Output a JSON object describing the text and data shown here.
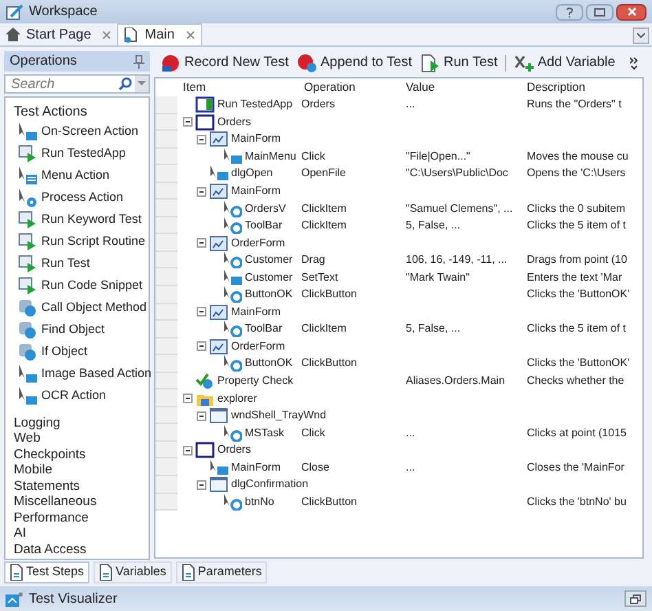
{
  "window": {
    "title": "Workspace"
  },
  "tabs": [
    {
      "label": "Start Page",
      "kind": "home",
      "selected": false
    },
    {
      "label": "Main",
      "kind": "test",
      "selected": true
    }
  ],
  "operations": {
    "title": "Operations",
    "search": {
      "placeholder": "Search"
    },
    "group": "Test Actions",
    "actions": [
      {
        "label": "On-Screen Action",
        "kind": "screen"
      },
      {
        "label": "Run TestedApp",
        "kind": "run"
      },
      {
        "label": "Menu Action",
        "kind": "menu"
      },
      {
        "label": "Process Action",
        "kind": "process"
      },
      {
        "label": "Run Keyword Test",
        "kind": "run"
      },
      {
        "label": "Run Script Routine",
        "kind": "run"
      },
      {
        "label": "Run Test",
        "kind": "run"
      },
      {
        "label": "Run Code Snippet",
        "kind": "run"
      },
      {
        "label": "Call Object Method",
        "kind": "object"
      },
      {
        "label": "Find Object",
        "kind": "object"
      },
      {
        "label": "If Object",
        "kind": "object"
      },
      {
        "label": "Image Based Action",
        "kind": "screen"
      },
      {
        "label": "OCR Action",
        "kind": "screen"
      }
    ],
    "categories": [
      "Logging",
      "Web",
      "Checkpoints",
      "Mobile",
      "Statements",
      "Miscellaneous",
      "Performance",
      "AI",
      "Data Access"
    ]
  },
  "toolbar": [
    {
      "label": "Record New Test",
      "kind": "record"
    },
    {
      "label": "Append to Test",
      "kind": "append"
    },
    {
      "label": "Run Test",
      "kind": "run"
    },
    {
      "label": "Add Variable",
      "kind": "variable"
    }
  ],
  "table": {
    "columns": [
      "Item",
      "Operation",
      "Value",
      "Description"
    ],
    "rows": [
      {
        "item": "Run TestedApp",
        "kind": "app",
        "operation": "Orders",
        "value": "...",
        "description": "Runs the \"Orders\" t"
      },
      {
        "item": "Orders",
        "kind": "process",
        "expanded": true,
        "children": [
          {
            "item": "MainForm",
            "kind": "form",
            "expanded": true,
            "children": [
              {
                "item": "MainMenu",
                "kind": "screen",
                "operation": "Click",
                "value": "\"File|Open...\"",
                "description": "Moves the mouse cu"
              }
            ]
          },
          {
            "item": "dlgOpen",
            "kind": "screen",
            "operation": "OpenFile",
            "value": "\"C:\\Users\\Public\\Doc",
            "description": "Opens the 'C:\\Users"
          },
          {
            "item": "MainForm",
            "kind": "form",
            "expanded": true,
            "children": [
              {
                "item": "OrdersV",
                "kind": "action",
                "operation": "ClickItem",
                "value": "\"Samuel Clemens\", ...",
                "description": "Clicks the 0 subitem"
              },
              {
                "item": "ToolBar",
                "kind": "action",
                "operation": "ClickItem",
                "value": "5, False, ...",
                "description": "Clicks the 5 item of t"
              }
            ]
          },
          {
            "item": "OrderForm",
            "kind": "form",
            "expanded": true,
            "children": [
              {
                "item": "Customer",
                "kind": "action",
                "operation": "Drag",
                "value": "106, 16, -149, -11, ...",
                "description": "Drags from point (10"
              },
              {
                "item": "Customer",
                "kind": "screen",
                "operation": "SetText",
                "value": "\"Mark Twain\"",
                "description": "Enters the text 'Mar"
              },
              {
                "item": "ButtonOK",
                "kind": "action",
                "operation": "ClickButton",
                "description": "Clicks the 'ButtonOK'"
              }
            ]
          },
          {
            "item": "MainForm",
            "kind": "form",
            "expanded": true,
            "children": [
              {
                "item": "ToolBar",
                "kind": "action",
                "operation": "ClickItem",
                "value": "5, False, ...",
                "description": "Clicks the 5 item of t"
              }
            ]
          },
          {
            "item": "OrderForm",
            "kind": "form",
            "expanded": true,
            "children": [
              {
                "item": "ButtonOK",
                "kind": "action",
                "operation": "ClickButton",
                "description": "Clicks the 'ButtonOK'"
              }
            ]
          }
        ]
      },
      {
        "item": "Property Check",
        "kind": "check",
        "value": "Aliases.Orders.Main",
        "description": "Checks whether the"
      },
      {
        "item": "explorer",
        "kind": "explorer",
        "expanded": true,
        "children": [
          {
            "item": "wndShell_TrayWnd",
            "kind": "window",
            "expanded": true,
            "children": [
              {
                "item": "MSTask",
                "kind": "action",
                "operation": "Click",
                "value": "...",
                "description": "Clicks at point (1015"
              }
            ]
          }
        ]
      },
      {
        "item": "Orders",
        "kind": "process",
        "expanded": true,
        "children": [
          {
            "item": "MainForm",
            "kind": "screen",
            "operation": "Close",
            "value": "...",
            "description": "Closes the 'MainFor"
          },
          {
            "item": "dlgConfirmation",
            "kind": "window",
            "expanded": true,
            "children": [
              {
                "item": "btnNo",
                "kind": "action",
                "operation": "ClickButton",
                "description": "Clicks the 'btnNo' bu"
              }
            ]
          }
        ]
      }
    ]
  },
  "bottom_tabs": [
    {
      "label": "Test Steps",
      "selected": true
    },
    {
      "label": "Variables",
      "selected": false
    },
    {
      "label": "Parameters",
      "selected": false
    }
  ],
  "status_bar": {
    "label": "Test Visualizer"
  }
}
